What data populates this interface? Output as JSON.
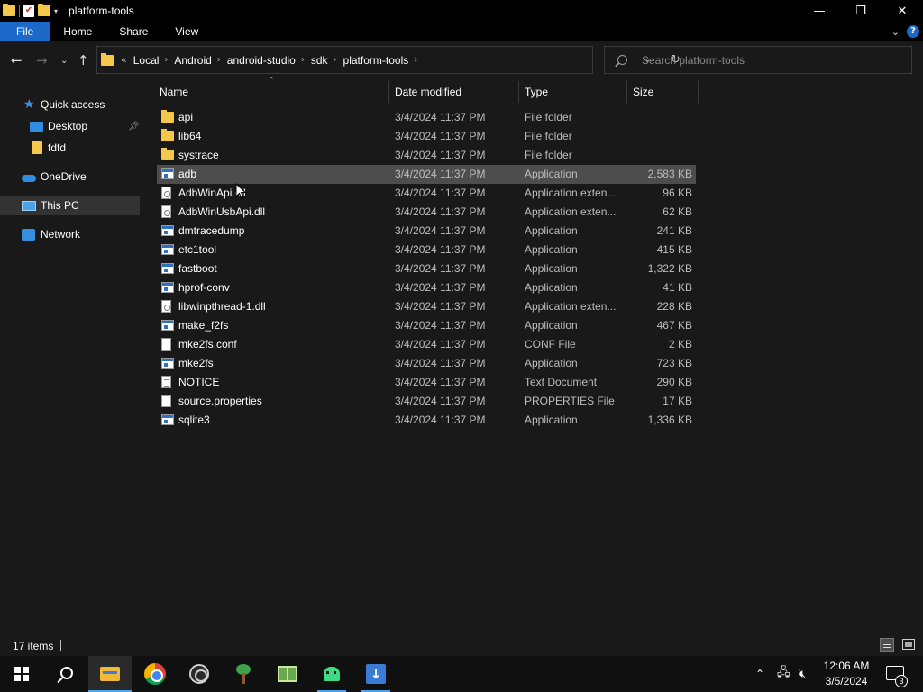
{
  "window": {
    "title": "platform-tools",
    "controls": {
      "minimize": "—",
      "maximize": "❐",
      "close": "✕"
    }
  },
  "ribbon": {
    "tabs": [
      {
        "label": "File",
        "active": true
      },
      {
        "label": "Home",
        "active": false
      },
      {
        "label": "Share",
        "active": false
      },
      {
        "label": "View",
        "active": false
      }
    ],
    "expand_icon": "chevron-down-icon",
    "help_icon": "help-icon"
  },
  "address": {
    "overflow": "«",
    "breadcrumbs": [
      "Local",
      "Android",
      "android-studio",
      "sdk",
      "platform-tools"
    ],
    "separator": "›"
  },
  "search": {
    "placeholder": "Search platform-tools"
  },
  "sidebar": {
    "items": [
      {
        "label": "Quick access",
        "icon": "star-icon",
        "selected": false
      },
      {
        "label": "Desktop",
        "icon": "desktop-icon",
        "pinned": true,
        "selected": false
      },
      {
        "label": "fdfd",
        "icon": "folder-icon",
        "selected": false
      },
      {
        "label": "OneDrive",
        "icon": "cloud-icon",
        "selected": false
      },
      {
        "label": "This PC",
        "icon": "computer-icon",
        "selected": true
      },
      {
        "label": "Network",
        "icon": "network-icon",
        "selected": false
      }
    ]
  },
  "columns": {
    "name": "Name",
    "date": "Date modified",
    "type": "Type",
    "size": "Size"
  },
  "files": [
    {
      "name": "api",
      "date": "3/4/2024 11:37 PM",
      "type": "File folder",
      "size": "",
      "icon": "folder"
    },
    {
      "name": "lib64",
      "date": "3/4/2024 11:37 PM",
      "type": "File folder",
      "size": "",
      "icon": "folder"
    },
    {
      "name": "systrace",
      "date": "3/4/2024 11:37 PM",
      "type": "File folder",
      "size": "",
      "icon": "folder"
    },
    {
      "name": "adb",
      "date": "3/4/2024 11:37 PM",
      "type": "Application",
      "size": "2,583 KB",
      "icon": "app",
      "selected": true
    },
    {
      "name": "AdbWinApi.dll",
      "date": "3/4/2024 11:37 PM",
      "type": "Application exten...",
      "size": "96 KB",
      "icon": "dll"
    },
    {
      "name": "AdbWinUsbApi.dll",
      "date": "3/4/2024 11:37 PM",
      "type": "Application exten...",
      "size": "62 KB",
      "icon": "dll"
    },
    {
      "name": "dmtracedump",
      "date": "3/4/2024 11:37 PM",
      "type": "Application",
      "size": "241 KB",
      "icon": "app"
    },
    {
      "name": "etc1tool",
      "date": "3/4/2024 11:37 PM",
      "type": "Application",
      "size": "415 KB",
      "icon": "app"
    },
    {
      "name": "fastboot",
      "date": "3/4/2024 11:37 PM",
      "type": "Application",
      "size": "1,322 KB",
      "icon": "app"
    },
    {
      "name": "hprof-conv",
      "date": "3/4/2024 11:37 PM",
      "type": "Application",
      "size": "41 KB",
      "icon": "app"
    },
    {
      "name": "libwinpthread-1.dll",
      "date": "3/4/2024 11:37 PM",
      "type": "Application exten...",
      "size": "228 KB",
      "icon": "dll"
    },
    {
      "name": "make_f2fs",
      "date": "3/4/2024 11:37 PM",
      "type": "Application",
      "size": "467 KB",
      "icon": "app"
    },
    {
      "name": "mke2fs.conf",
      "date": "3/4/2024 11:37 PM",
      "type": "CONF File",
      "size": "2 KB",
      "icon": "doc"
    },
    {
      "name": "mke2fs",
      "date": "3/4/2024 11:37 PM",
      "type": "Application",
      "size": "723 KB",
      "icon": "app"
    },
    {
      "name": "NOTICE",
      "date": "3/4/2024 11:37 PM",
      "type": "Text Document",
      "size": "290 KB",
      "icon": "txt"
    },
    {
      "name": "source.properties",
      "date": "3/4/2024 11:37 PM",
      "type": "PROPERTIES File",
      "size": "17 KB",
      "icon": "doc"
    },
    {
      "name": "sqlite3",
      "date": "3/4/2024 11:37 PM",
      "type": "Application",
      "size": "1,336 KB",
      "icon": "app"
    }
  ],
  "status": {
    "count": "17 items"
  },
  "taskbar": {
    "apps": [
      {
        "name": "start-button",
        "icon": "windows-icon"
      },
      {
        "name": "search-button",
        "icon": "search-icon"
      },
      {
        "name": "file-explorer",
        "icon": "file-explorer-icon"
      },
      {
        "name": "chrome",
        "icon": "chrome-icon"
      },
      {
        "name": "obs",
        "icon": "obs-icon"
      },
      {
        "name": "tree-app",
        "icon": "tree-icon"
      },
      {
        "name": "book-app",
        "icon": "book-icon"
      },
      {
        "name": "android-app",
        "icon": "android-icon"
      },
      {
        "name": "installer-app",
        "icon": "installer-icon"
      }
    ],
    "clock_time": "12:06 AM",
    "clock_date": "3/5/2024",
    "notification_count": "3"
  }
}
